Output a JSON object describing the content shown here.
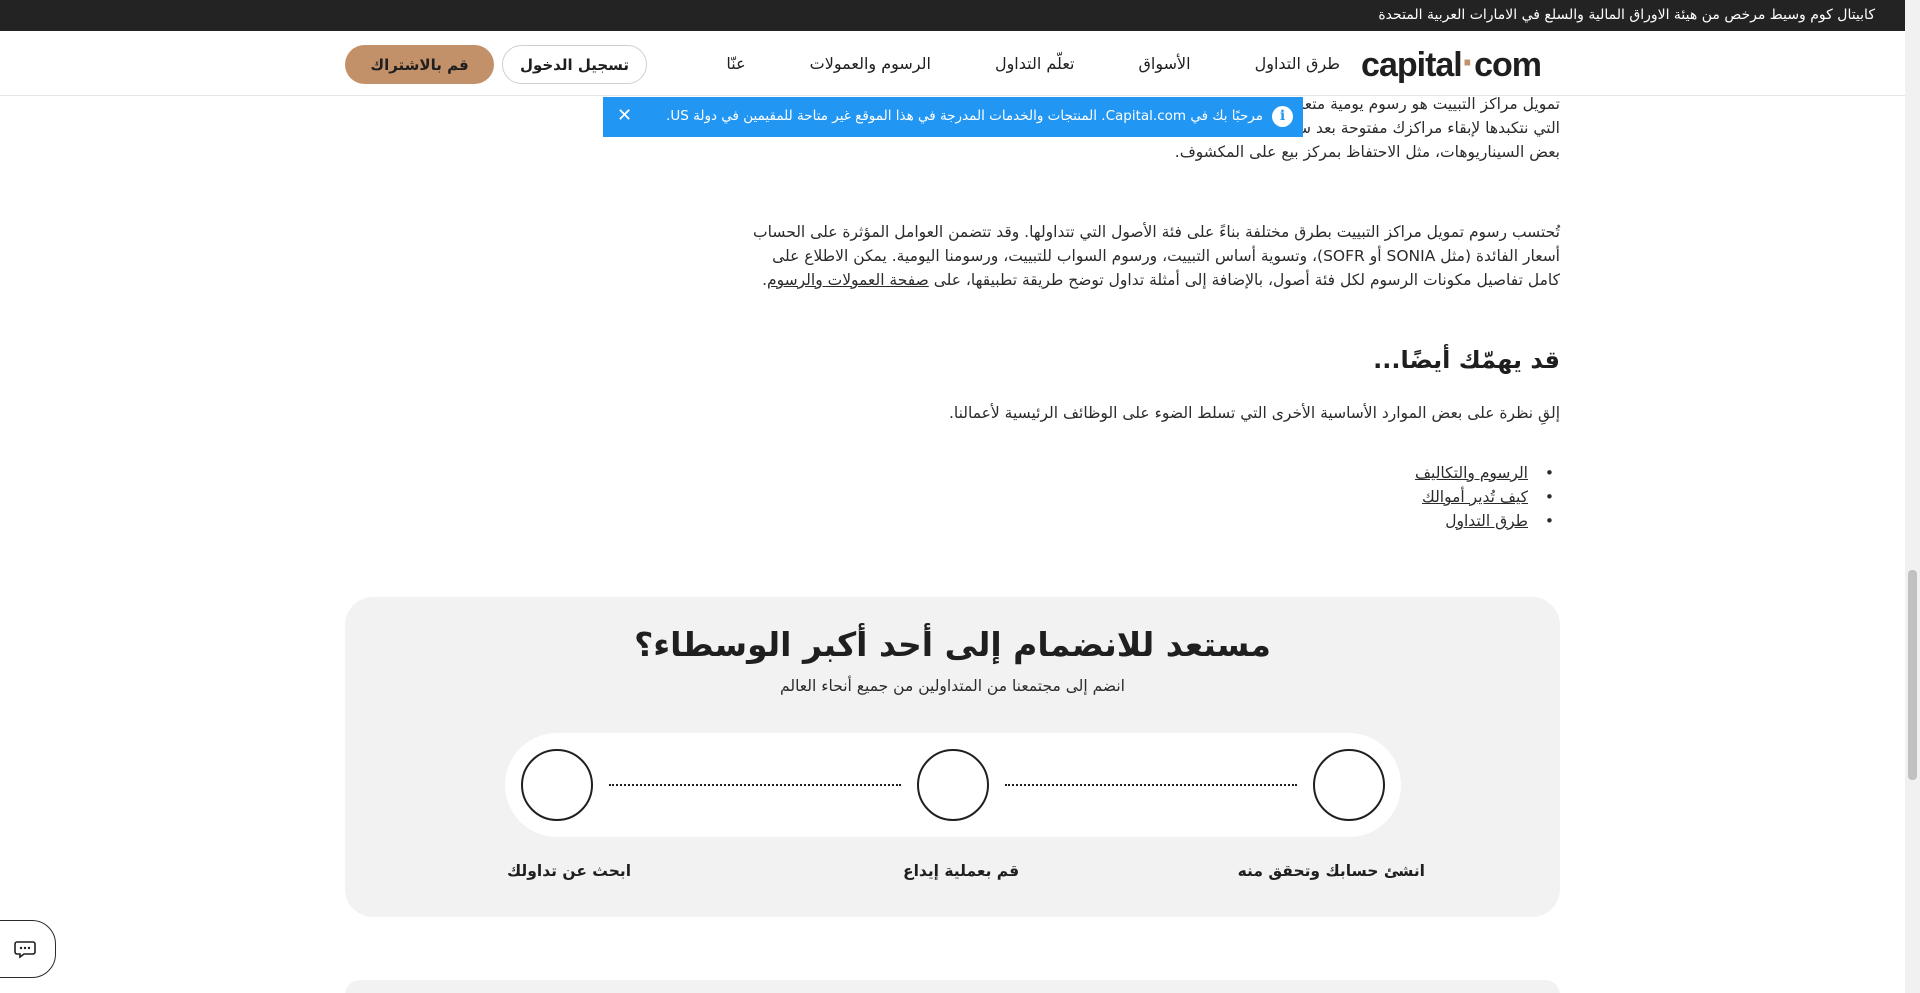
{
  "top_strip": {
    "text": "كابيتال كوم وسيط مرخص من هيئة الاوراق المالية والسلع في الامارات العربية المتحدة"
  },
  "header": {
    "logo": {
      "part1": "capital",
      "dot": "·",
      "part2": "com"
    },
    "nav": [
      "طرق التداول",
      "الأسواق",
      "تعلّم التداول",
      "الرسوم والعمولات",
      "عنّا"
    ],
    "login_label": "تسجيل الدخول",
    "signup_label": "قم بالاشتراك"
  },
  "banner": {
    "message": "مرحبًا بك في Capital.com. المنتجات والخدمات المدرجة في هذا الموقع غير متاحة للمقيمين في دولة US.",
    "close": "✕",
    "info": "i"
  },
  "article": {
    "para1": "تمويل مراكز التبييت هو رسوم يومية متعلقة بالمراكز المفتوحة بين عشية وضحاها، ويتم بتحصيل هذه الرسوم لتعويض التكاليف التي نتكبدها لإبقاء مراكزك مفتوحة بعد ساعات التداول المعتادة للسوق. ومع ذلك، يمكن أن يُضاف هذا التمويل إلى رصيدك في بعض السيناريوهات، مثل الاحتفاظ بمركز بيع على المكشوف.",
    "para2_text": "تُحتسب رسوم تمويل مراكز التبييت بطرق مختلفة بناءً على فئة الأصول التي تتداولها. وقد تتضمن العوامل المؤثرة على الحساب أسعار الفائدة (مثل SONIA أو SOFR)، وتسوية أساس التبييت، ورسوم السواب للتبييت، ورسومنا اليومية. يمكن الاطلاع على كامل تفاصيل مكونات الرسوم لكل فئة أصول، بالإضافة إلى أمثلة تداول توضح طريقة تطبيقها، على ",
    "para2_link": "صفحة العمولات والرسوم",
    "para2_end": ".",
    "related_title": "قد يهمّك أيضًا...",
    "related_intro": "إلقِ نظرة على بعض الموارد الأساسية الأخرى التي تسلط الضوء على الوظائف الرئيسية لأعمالنا.",
    "related_links": [
      "الرسوم والتكاليف",
      "كيف تُدير أموالك",
      "طرق التداول"
    ]
  },
  "cta": {
    "title": "مستعد للانضمام إلى أحد أكبر الوسطاء؟",
    "subtitle": "انضم إلى مجتمعنا من المتداولين من جميع أنحاء العالم",
    "steps": [
      "انشئ حسابك وتحقق منه",
      "قم بعملية إيداع",
      "ابحث عن تداولك"
    ]
  },
  "chat": {
    "icon": "chat-icon"
  }
}
